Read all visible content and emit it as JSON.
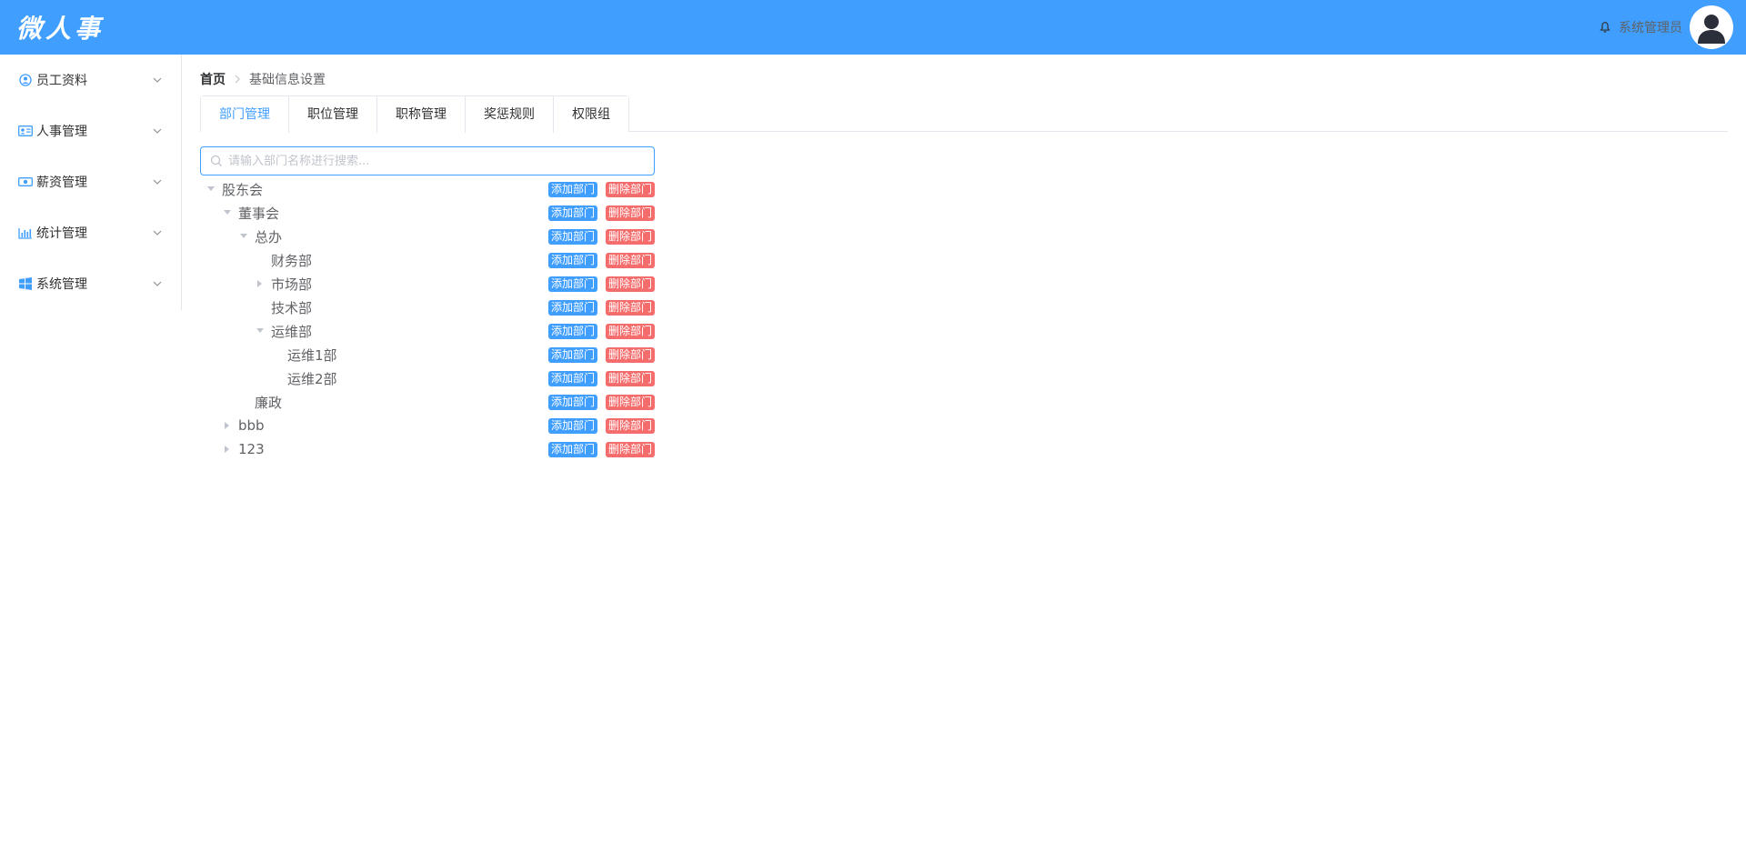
{
  "app": {
    "logo": "微人事",
    "user_name": "系统管理员"
  },
  "colors": {
    "primary": "#409eff",
    "danger": "#f56c6c",
    "text": "#303133",
    "muted": "#606266"
  },
  "sidebar": {
    "items": [
      {
        "label": "员工资料",
        "icon": "user-circle-icon"
      },
      {
        "label": "人事管理",
        "icon": "id-card-icon"
      },
      {
        "label": "薪资管理",
        "icon": "money-icon"
      },
      {
        "label": "统计管理",
        "icon": "bar-chart-icon"
      },
      {
        "label": "系统管理",
        "icon": "windows-icon"
      }
    ]
  },
  "breadcrumb": {
    "home": "首页",
    "current": "基础信息设置"
  },
  "tabs": [
    {
      "label": "部门管理",
      "active": true
    },
    {
      "label": "职位管理",
      "active": false
    },
    {
      "label": "职称管理",
      "active": false
    },
    {
      "label": "奖惩规则",
      "active": false
    },
    {
      "label": "权限组",
      "active": false
    }
  ],
  "search": {
    "placeholder": "请输入部门名称进行搜索...",
    "value": ""
  },
  "buttons": {
    "add": "添加部门",
    "delete": "删除部门"
  },
  "tree": [
    {
      "label": "股东会",
      "level": 0,
      "state": "expanded"
    },
    {
      "label": "董事会",
      "level": 1,
      "state": "expanded"
    },
    {
      "label": "总办",
      "level": 2,
      "state": "expanded"
    },
    {
      "label": "财务部",
      "level": 3,
      "state": "leaf"
    },
    {
      "label": "市场部",
      "level": 3,
      "state": "collapsed"
    },
    {
      "label": "技术部",
      "level": 3,
      "state": "leaf"
    },
    {
      "label": "运维部",
      "level": 3,
      "state": "expanded"
    },
    {
      "label": "运维1部",
      "level": 4,
      "state": "leaf"
    },
    {
      "label": "运维2部",
      "level": 4,
      "state": "leaf"
    },
    {
      "label": "廉政",
      "level": 2,
      "state": "leaf"
    },
    {
      "label": "bbb",
      "level": 1,
      "state": "collapsed"
    },
    {
      "label": "123",
      "level": 1,
      "state": "collapsed"
    }
  ]
}
